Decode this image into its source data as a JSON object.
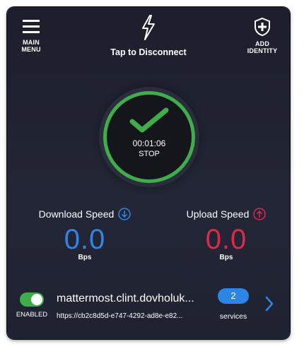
{
  "header": {
    "menu_label_line1": "MAIN",
    "menu_label_line2": "MENU",
    "identity_label_line1": "ADD",
    "identity_label_line2": "IDENTITY",
    "connect_label": "Tap to Disconnect"
  },
  "status": {
    "timer": "00:01:06",
    "stop_label": "STOP",
    "ring_color": "#3fae4a"
  },
  "download": {
    "title": "Download Speed",
    "value": "0.0",
    "unit": "Bps",
    "color": "#2d86e6"
  },
  "upload": {
    "title": "Upload Speed",
    "value": "0.0",
    "unit": "Bps",
    "color": "#e1284a"
  },
  "service": {
    "enabled_label": "ENABLED",
    "name": "mattermost.clint.dovholuk...",
    "url": "https://cb2c8d5d-e747-4292-ad8e-e82...",
    "count": "2",
    "count_label": "services"
  }
}
